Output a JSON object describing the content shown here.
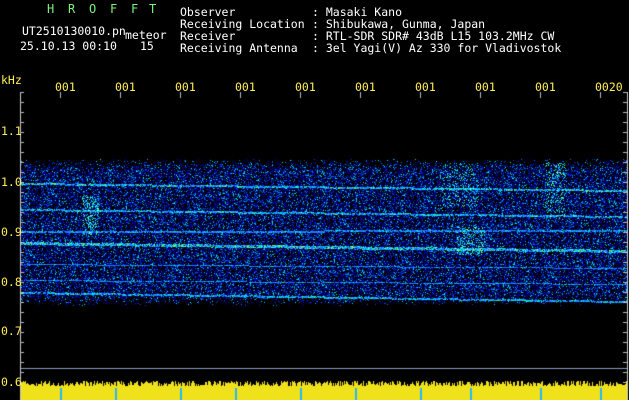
{
  "header": {
    "station_letters": [
      "H",
      "R",
      "O",
      "F",
      "F",
      "T"
    ],
    "filename": "UT2510130010.pn",
    "filename_suffix": "meteor",
    "datetime": "25.10.13 00:10",
    "interval": "15",
    "observer_label": "Observer",
    "location_label": "Receiving Location",
    "receiver_label": "Receiver",
    "antenna_label": "Receiving Antenna",
    "observer_value": ": Masaki Kano",
    "location_value": ": Shibukawa, Gunma, Japan",
    "receiver_value": ": RTL-SDR SDR# 43dB L15 103.2MHz CW",
    "antenna_value": ": 3el Yagi(V) Az 330 for Vladivostok"
  },
  "axis": {
    "unit": "kHz",
    "time_ticks": [
      "001",
      "001",
      "001",
      "001",
      "001",
      "001",
      "001",
      "001",
      "001",
      "0020"
    ],
    "freq_ticks": [
      "1.1",
      "1.0",
      "0.9",
      "0.8",
      "0.7",
      "0.6"
    ]
  },
  "colors": {
    "text_white": "#ffffff",
    "text_green": "#7cf07c",
    "text_yellow": "#ffee55",
    "background": "#000000"
  }
}
